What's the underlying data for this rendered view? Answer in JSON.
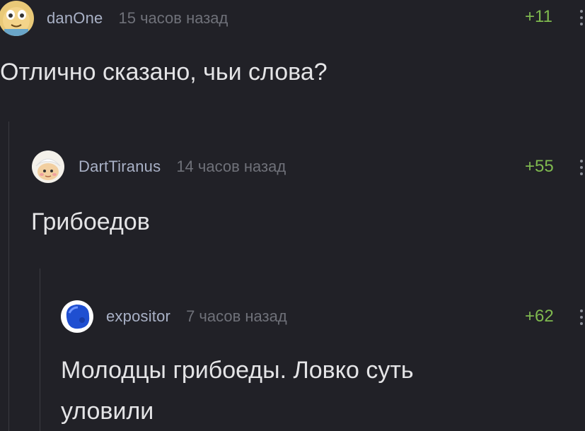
{
  "comments": [
    {
      "username": "danOne",
      "timestamp": "15 часов назад",
      "rating": "+11",
      "text": "Отлично сказано, чьи слова?",
      "avatar_icon": "cartoon-cat-avatar-icon"
    },
    {
      "username": "DartTiranus",
      "timestamp": "14 часов назад",
      "rating": "+55",
      "text": "Грибоедов",
      "avatar_icon": "cartoon-face-avatar-icon"
    },
    {
      "username": "expositor",
      "timestamp": "7 часов назад",
      "rating": "+62",
      "text_line1": "Молодцы грибоеды. Ловко суть",
      "text_line2": "уловили",
      "avatar_icon": "blue-blob-avatar-icon"
    }
  ],
  "colors": {
    "background": "#212127",
    "username": "#a9b1c6",
    "timestamp": "#6f7179",
    "rating_positive": "#7fb94f",
    "text": "#e4e4e6"
  }
}
